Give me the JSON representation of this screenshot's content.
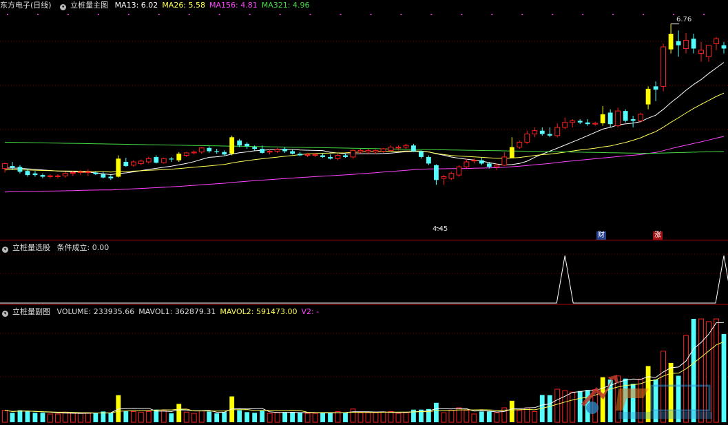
{
  "main": {
    "stock": "东方电子",
    "period": "(日线)",
    "indicator": "立桩量主图",
    "ma": [
      {
        "label": "MA13: 6.02",
        "color": "#ffffff"
      },
      {
        "label": "MA26: 5.58",
        "color": "#ffff55"
      },
      {
        "label": "MA156: 4.81",
        "color": "#ff44ff"
      },
      {
        "label": "MA321: 4.96",
        "color": "#44dd44"
      }
    ],
    "high_label": "6.76",
    "low_label": "4.45",
    "tag_cai": "财",
    "tag_zhang": "涨"
  },
  "select": {
    "name": "立桩量选股",
    "condition": "条件成立: 0.00"
  },
  "volume": {
    "name": "立桩量副图",
    "labels": [
      {
        "label": "VOLUME: 233935.66",
        "color": "#dddddd"
      },
      {
        "label": "MAVOL1: 362879.31",
        "color": "#dddddd"
      },
      {
        "label": "MAVOL2: 591473.00",
        "color": "#ffff55"
      },
      {
        "label": "V2: -",
        "color": "#ff44ff"
      }
    ]
  },
  "colors": {
    "up": "#ff2020",
    "down": "#54fcfc",
    "pile": "#ffff00",
    "grid": "#7a0000",
    "ma13": "#ffffff",
    "ma26": "#ffff55",
    "ma156": "#ff44ff",
    "ma321": "#44dd44"
  },
  "chart_data": [
    {
      "type": "candlestick",
      "price_range": [
        4.2,
        6.9
      ],
      "candles": [
        {
          "o": 5.0,
          "h": 5.07,
          "l": 4.95,
          "c": 5.06
        },
        {
          "o": 5.03,
          "h": 5.08,
          "l": 4.98,
          "c": 5.01
        },
        {
          "o": 5.02,
          "h": 5.04,
          "l": 4.94,
          "c": 4.96
        },
        {
          "o": 4.97,
          "h": 5.0,
          "l": 4.9,
          "c": 4.92
        },
        {
          "o": 4.94,
          "h": 4.97,
          "l": 4.9,
          "c": 4.92
        },
        {
          "o": 4.92,
          "h": 4.94,
          "l": 4.88,
          "c": 4.9
        },
        {
          "o": 4.91,
          "h": 4.93,
          "l": 4.88,
          "c": 4.91
        },
        {
          "o": 4.91,
          "h": 4.93,
          "l": 4.88,
          "c": 4.91
        },
        {
          "o": 4.91,
          "h": 4.96,
          "l": 4.89,
          "c": 4.94
        },
        {
          "o": 4.94,
          "h": 4.97,
          "l": 4.91,
          "c": 4.95
        },
        {
          "o": 4.95,
          "h": 4.98,
          "l": 4.92,
          "c": 4.96
        },
        {
          "o": 4.95,
          "h": 4.99,
          "l": 4.91,
          "c": 4.96
        },
        {
          "o": 4.95,
          "h": 4.96,
          "l": 4.92,
          "c": 4.93
        },
        {
          "o": 4.93,
          "h": 4.96,
          "l": 4.88,
          "c": 4.89
        },
        {
          "o": 4.9,
          "h": 4.92,
          "l": 4.86,
          "c": 4.88
        },
        {
          "o": 4.9,
          "h": 5.16,
          "l": 4.89,
          "c": 5.12,
          "p": 1
        },
        {
          "o": 5.08,
          "h": 5.13,
          "l": 5.02,
          "c": 5.03
        },
        {
          "o": 5.04,
          "h": 5.1,
          "l": 5.02,
          "c": 5.08
        },
        {
          "o": 5.06,
          "h": 5.11,
          "l": 5.04,
          "c": 5.09
        },
        {
          "o": 5.08,
          "h": 5.14,
          "l": 5.06,
          "c": 5.12
        },
        {
          "o": 5.14,
          "h": 5.16,
          "l": 5.06,
          "c": 5.07
        },
        {
          "o": 5.07,
          "h": 5.13,
          "l": 5.06,
          "c": 5.12
        },
        {
          "o": 5.12,
          "h": 5.14,
          "l": 5.08,
          "c": 5.11
        },
        {
          "o": 5.1,
          "h": 5.2,
          "l": 5.08,
          "c": 5.18,
          "p": 1
        },
        {
          "o": 5.16,
          "h": 5.2,
          "l": 5.14,
          "c": 5.19
        },
        {
          "o": 5.19,
          "h": 5.22,
          "l": 5.17,
          "c": 5.2
        },
        {
          "o": 5.2,
          "h": 5.26,
          "l": 5.18,
          "c": 5.25
        },
        {
          "o": 5.25,
          "h": 5.27,
          "l": 5.19,
          "c": 5.21
        },
        {
          "o": 5.21,
          "h": 5.24,
          "l": 5.18,
          "c": 5.2
        },
        {
          "o": 5.2,
          "h": 5.22,
          "l": 5.16,
          "c": 5.17
        },
        {
          "o": 5.18,
          "h": 5.4,
          "l": 5.16,
          "c": 5.38,
          "p": 1
        },
        {
          "o": 5.34,
          "h": 5.36,
          "l": 5.26,
          "c": 5.28
        },
        {
          "o": 5.3,
          "h": 5.32,
          "l": 5.24,
          "c": 5.27
        },
        {
          "o": 5.26,
          "h": 5.28,
          "l": 5.22,
          "c": 5.24
        },
        {
          "o": 5.24,
          "h": 5.28,
          "l": 5.18,
          "c": 5.19
        },
        {
          "o": 5.2,
          "h": 5.23,
          "l": 5.17,
          "c": 5.21
        },
        {
          "o": 5.21,
          "h": 5.25,
          "l": 5.19,
          "c": 5.23
        },
        {
          "o": 5.24,
          "h": 5.26,
          "l": 5.19,
          "c": 5.21
        },
        {
          "o": 5.21,
          "h": 5.23,
          "l": 5.17,
          "c": 5.18
        },
        {
          "o": 5.18,
          "h": 5.2,
          "l": 5.15,
          "c": 5.16
        },
        {
          "o": 5.16,
          "h": 5.19,
          "l": 5.14,
          "c": 5.17
        },
        {
          "o": 5.16,
          "h": 5.19,
          "l": 5.14,
          "c": 5.17
        },
        {
          "o": 5.16,
          "h": 5.19,
          "l": 5.13,
          "c": 5.14
        },
        {
          "o": 5.14,
          "h": 5.17,
          "l": 5.11,
          "c": 5.12
        },
        {
          "o": 5.12,
          "h": 5.18,
          "l": 5.1,
          "c": 5.16
        },
        {
          "o": 5.16,
          "h": 5.19,
          "l": 5.13,
          "c": 5.14
        },
        {
          "o": 5.14,
          "h": 5.23,
          "l": 5.12,
          "c": 5.22
        },
        {
          "o": 5.2,
          "h": 5.24,
          "l": 5.18,
          "c": 5.22
        },
        {
          "o": 5.2,
          "h": 5.24,
          "l": 5.17,
          "c": 5.22
        },
        {
          "o": 5.2,
          "h": 5.23,
          "l": 5.17,
          "c": 5.22
        },
        {
          "o": 5.21,
          "h": 5.25,
          "l": 5.19,
          "c": 5.24
        },
        {
          "o": 5.22,
          "h": 5.28,
          "l": 5.21,
          "c": 5.26
        },
        {
          "o": 5.25,
          "h": 5.28,
          "l": 5.22,
          "c": 5.26
        },
        {
          "o": 5.26,
          "h": 5.3,
          "l": 5.24,
          "c": 5.28
        },
        {
          "o": 5.28,
          "h": 5.3,
          "l": 5.2,
          "c": 5.21
        },
        {
          "o": 5.21,
          "h": 5.22,
          "l": 5.12,
          "c": 5.14
        },
        {
          "o": 5.14,
          "h": 5.16,
          "l": 5.04,
          "c": 5.06
        },
        {
          "o": 5.04,
          "h": 5.05,
          "l": 4.8,
          "c": 4.86
        },
        {
          "o": 4.88,
          "h": 4.92,
          "l": 4.8,
          "c": 4.9
        },
        {
          "o": 4.88,
          "h": 4.96,
          "l": 4.86,
          "c": 4.94
        },
        {
          "o": 4.92,
          "h": 5.04,
          "l": 4.9,
          "c": 5.02
        },
        {
          "o": 5.02,
          "h": 5.12,
          "l": 5.0,
          "c": 5.08
        },
        {
          "o": 5.1,
          "h": 5.12,
          "l": 5.06,
          "c": 5.1
        },
        {
          "o": 5.1,
          "h": 5.13,
          "l": 5.04,
          "c": 5.06
        },
        {
          "o": 5.06,
          "h": 5.08,
          "l": 5.0,
          "c": 5.02
        },
        {
          "o": 5.02,
          "h": 5.06,
          "l": 4.98,
          "c": 5.04
        },
        {
          "o": 5.04,
          "h": 5.2,
          "l": 5.03,
          "c": 5.14
        },
        {
          "o": 5.13,
          "h": 5.38,
          "l": 5.13,
          "c": 5.26,
          "p": 1
        },
        {
          "o": 5.26,
          "h": 5.34,
          "l": 5.24,
          "c": 5.32
        },
        {
          "o": 5.32,
          "h": 5.46,
          "l": 5.3,
          "c": 5.42
        },
        {
          "o": 5.42,
          "h": 5.5,
          "l": 5.38,
          "c": 5.46
        },
        {
          "o": 5.46,
          "h": 5.5,
          "l": 5.4,
          "c": 5.42
        },
        {
          "o": 5.42,
          "h": 5.5,
          "l": 5.38,
          "c": 5.4
        },
        {
          "o": 5.4,
          "h": 5.55,
          "l": 5.38,
          "c": 5.5
        },
        {
          "o": 5.5,
          "h": 5.62,
          "l": 5.48,
          "c": 5.56
        },
        {
          "o": 5.56,
          "h": 5.6,
          "l": 5.5,
          "c": 5.58
        },
        {
          "o": 5.58,
          "h": 5.6,
          "l": 5.54,
          "c": 5.56
        },
        {
          "o": 5.56,
          "h": 5.6,
          "l": 5.52,
          "c": 5.54
        },
        {
          "o": 5.54,
          "h": 5.57,
          "l": 5.52,
          "c": 5.55
        },
        {
          "o": 5.55,
          "h": 5.76,
          "l": 5.52,
          "c": 5.66,
          "p": 1
        },
        {
          "o": 5.68,
          "h": 5.72,
          "l": 5.5,
          "c": 5.54
        },
        {
          "o": 5.52,
          "h": 5.74,
          "l": 5.5,
          "c": 5.7
        },
        {
          "o": 5.7,
          "h": 5.72,
          "l": 5.56,
          "c": 5.58
        },
        {
          "o": 5.6,
          "h": 5.64,
          "l": 5.5,
          "c": 5.58
        },
        {
          "o": 5.58,
          "h": 5.68,
          "l": 5.56,
          "c": 5.66
        },
        {
          "o": 5.78,
          "h": 6.0,
          "l": 5.72,
          "c": 5.97,
          "p": 1
        },
        {
          "o": 6.0,
          "h": 6.06,
          "l": 5.82,
          "c": 5.96
        },
        {
          "o": 6.0,
          "h": 6.52,
          "l": 5.94,
          "c": 6.48
        },
        {
          "o": 6.45,
          "h": 6.76,
          "l": 6.4,
          "c": 6.64,
          "p": 1
        },
        {
          "o": 6.55,
          "h": 6.68,
          "l": 6.36,
          "c": 6.5
        },
        {
          "o": 6.46,
          "h": 6.65,
          "l": 6.4,
          "c": 6.56
        },
        {
          "o": 6.58,
          "h": 6.64,
          "l": 6.4,
          "c": 6.46
        },
        {
          "o": 6.4,
          "h": 6.54,
          "l": 6.3,
          "c": 6.44
        },
        {
          "o": 6.36,
          "h": 6.42,
          "l": 6.3,
          "c": 6.5
        },
        {
          "o": 6.52,
          "h": 6.6,
          "l": 6.44,
          "c": 6.58
        },
        {
          "o": 6.5,
          "h": 6.54,
          "l": 6.4,
          "c": 6.46
        }
      ],
      "high": 6.76,
      "low": 4.45
    },
    {
      "type": "line",
      "name": "立桩量选股",
      "signal_index": [
        74,
        95
      ],
      "value": 0.0
    },
    {
      "type": "bar",
      "name": "VOLUME",
      "last": 233935.66,
      "mavol1": 362879.31,
      "mavol2": 591473.0
    }
  ]
}
